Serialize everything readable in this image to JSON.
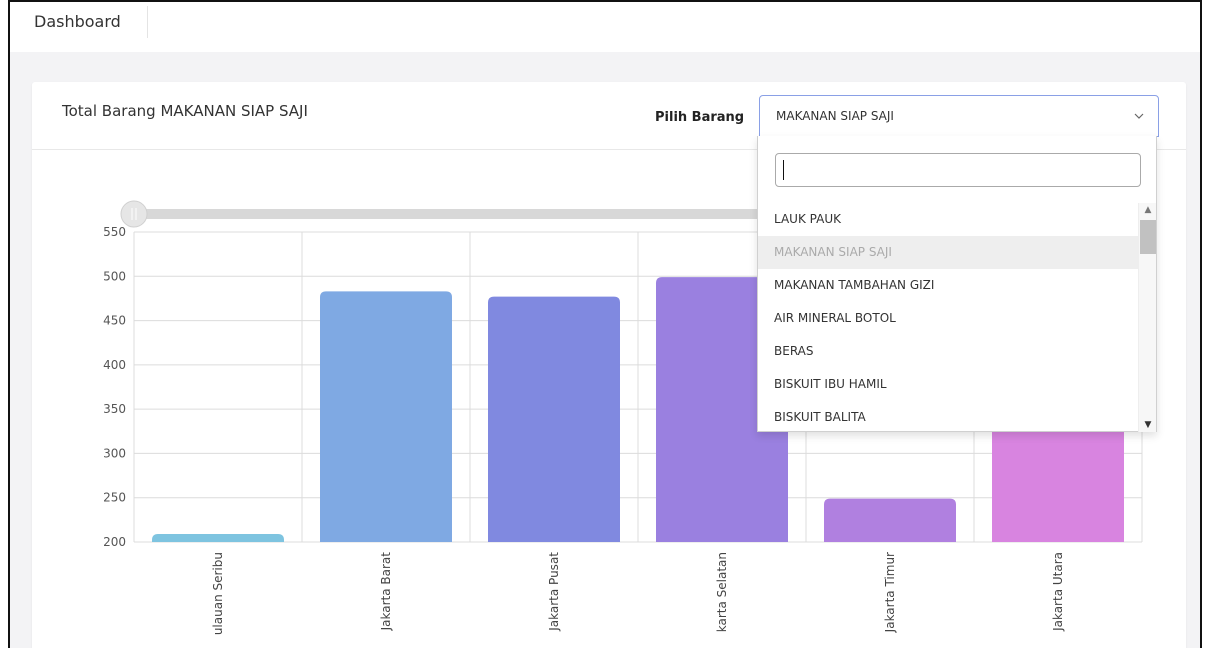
{
  "topbar": {
    "title": "Dashboard"
  },
  "card": {
    "title": "Total Barang MAKANAN SIAP SAJI",
    "pick_label": "Pilih Barang",
    "select_value": "MAKANAN SIAP SAJI"
  },
  "dropdown": {
    "search_value": "",
    "options": [
      {
        "label": "LAUK PAUK",
        "selected": false
      },
      {
        "label": "MAKANAN SIAP SAJI",
        "selected": true
      },
      {
        "label": "MAKANAN TAMBAHAN GIZI",
        "selected": false
      },
      {
        "label": "AIR MINERAL BOTOL",
        "selected": false
      },
      {
        "label": "BERAS",
        "selected": false
      },
      {
        "label": "BISKUIT IBU HAMIL",
        "selected": false
      },
      {
        "label": "BISKUIT BALITA",
        "selected": false
      }
    ]
  },
  "chart_data": {
    "type": "bar",
    "categories": [
      "Kepulauan Seribu",
      "Jakarta Barat",
      "Jakarta Pusat",
      "Jakarta Selatan",
      "Jakarta Timur",
      "Jakarta Utara"
    ],
    "visible_tick_text": [
      "ulauan Seribu",
      "Jakarta Barat",
      "Jakarta Pusat",
      "karta Selatan",
      "Jakarta Timur",
      "Jakarta Utara"
    ],
    "values": [
      209,
      483,
      477,
      499,
      249,
      500
    ],
    "colors": [
      "#7ec4e0",
      "#7fa9e3",
      "#8089e0",
      "#9a80e0",
      "#b080e0",
      "#d884e0"
    ],
    "ylim": [
      200,
      550
    ],
    "yticks": [
      200,
      250,
      300,
      350,
      400,
      450,
      500,
      550
    ],
    "grid": true,
    "zoom_slider": true
  }
}
